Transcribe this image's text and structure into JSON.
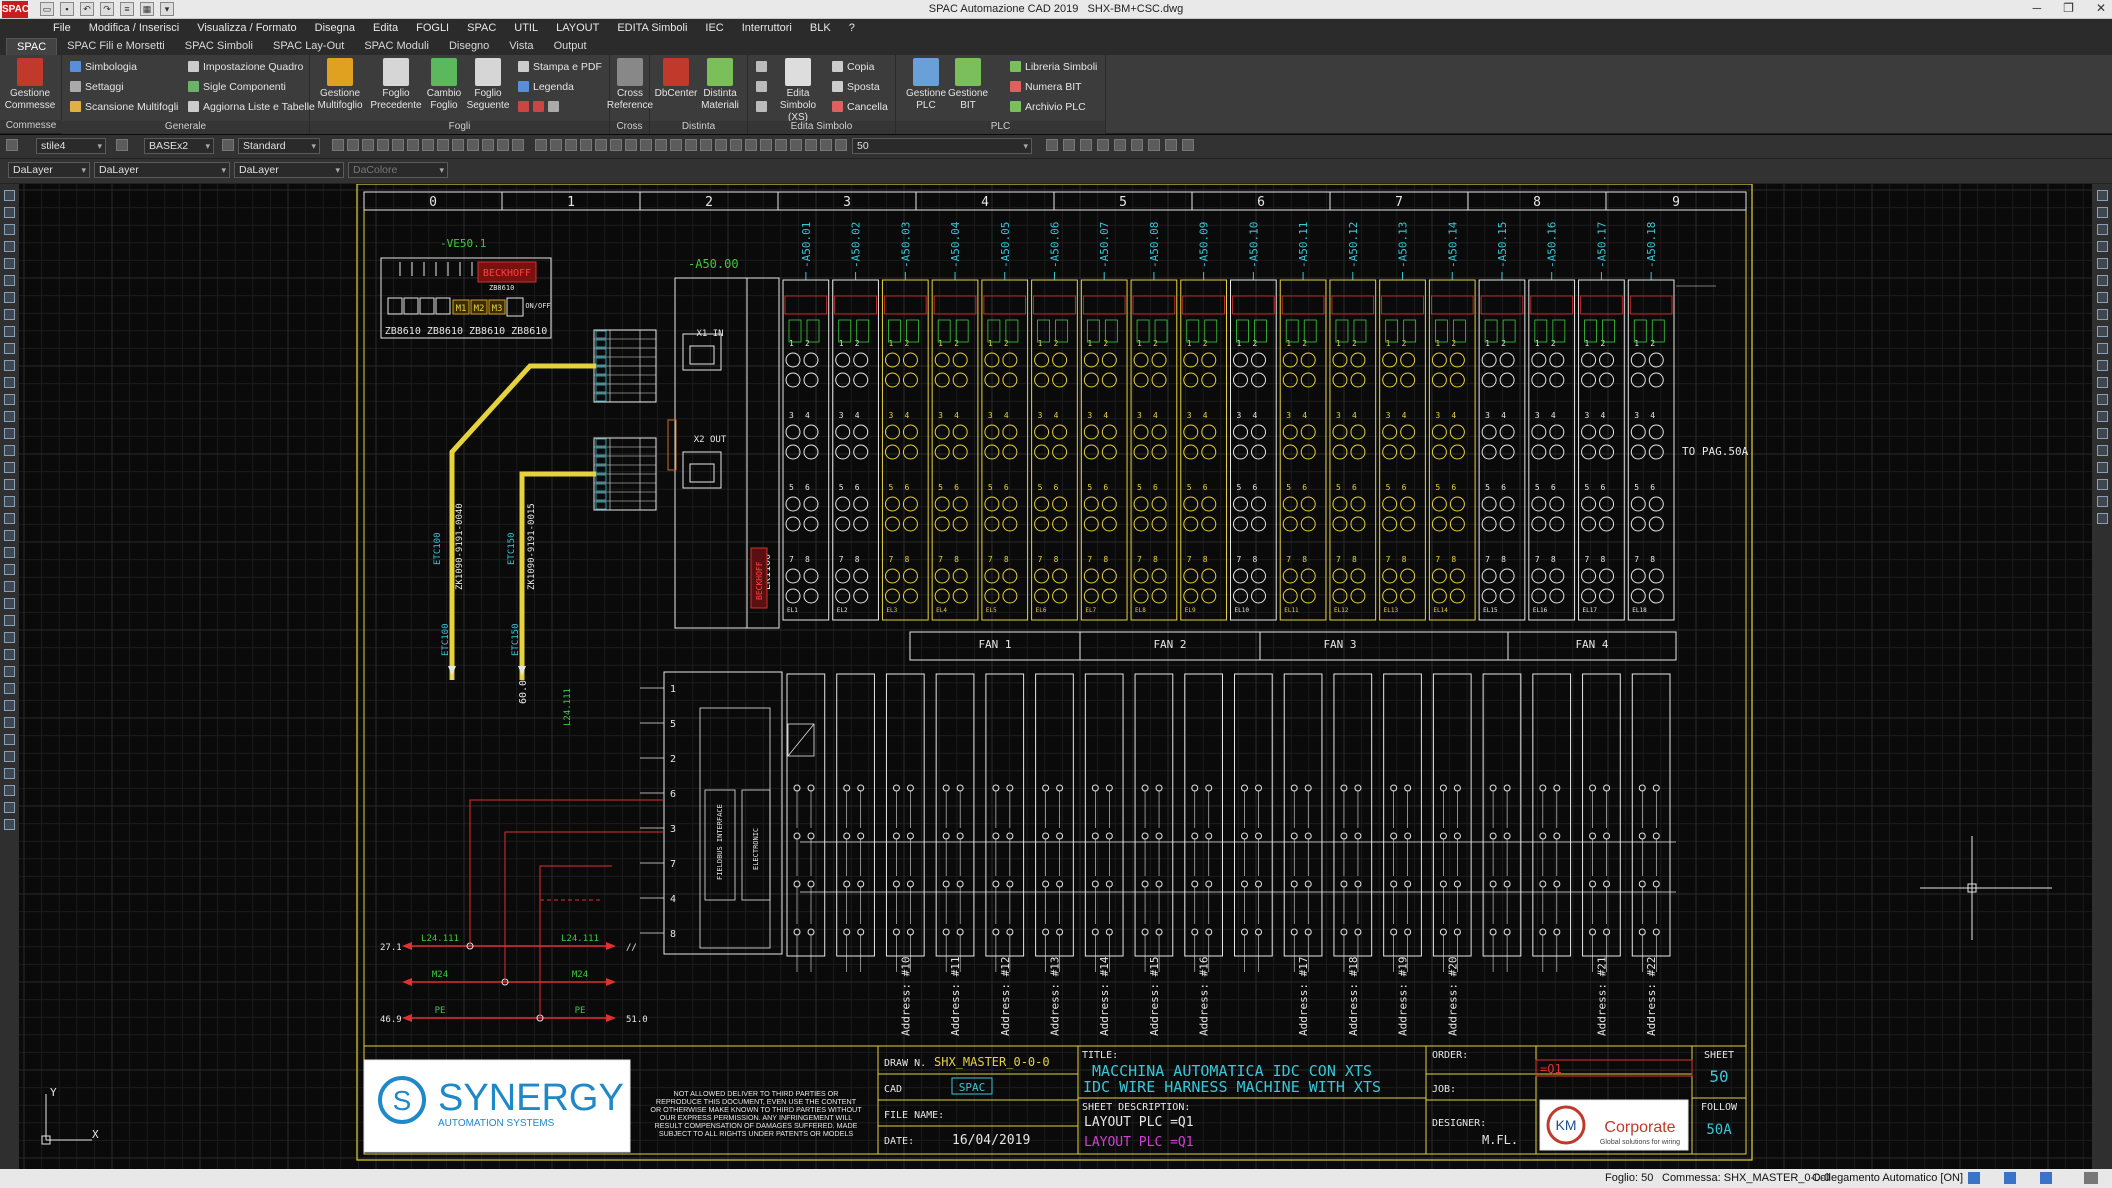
{
  "app": {
    "title": "SPAC Automazione CAD 2019",
    "file": "SHX-BM+CSC.dwg",
    "logo": "SPAC"
  },
  "menu": [
    "File",
    "Modifica / Inserisci",
    "Visualizza / Formato",
    "Disegna",
    "Edita",
    "FOGLI",
    "SPAC",
    "UTIL",
    "LAYOUT",
    "EDITA Simboli",
    "IEC",
    "Interruttori",
    "BLK",
    "?"
  ],
  "ribbon_tabs": [
    "SPAC",
    "SPAC Fili e Morsetti",
    "SPAC Simboli",
    "SPAC Lay-Out",
    "SPAC Moduli",
    "Disegno",
    "Vista",
    "Output"
  ],
  "ribbon": {
    "commesse": {
      "name": "Commesse",
      "gestione": "Gestione Commesse"
    },
    "generale": {
      "name": "Generale",
      "simbologia": "Simbologia",
      "settaggi": "Settaggi",
      "scansione": "Scansione Multifogli",
      "impostazione": "Impostazione Quadro",
      "sigle": "Sigle Componenti",
      "aggiorna": "Aggiorna Liste e Tabelle"
    },
    "fogli": {
      "name": "Fogli",
      "gestione": "Gestione Multifoglio",
      "precedente": "Foglio Precedente",
      "cambio": "Cambio Foglio",
      "seguente": "Foglio Seguente",
      "stampa": "Stampa e PDF",
      "legenda": "Legenda"
    },
    "cross": {
      "name": "Cross",
      "ref": "Cross Reference"
    },
    "distinta": {
      "name": "Distinta",
      "db": "DbCenter",
      "materiali": "Distinta Materiali"
    },
    "edita": {
      "name": "Edita Simbolo",
      "xs": "Edita Simbolo (XS)",
      "copia": "Copia",
      "sposta": "Sposta",
      "cancella": "Cancella"
    },
    "plc": {
      "name": "PLC",
      "gestione_plc": "Gestione PLC",
      "gestione_bit": "Gestione BIT",
      "libreria": "Libreria Simboli",
      "numera": "Numera BIT",
      "archivio": "Archivio PLC"
    }
  },
  "toolbar": {
    "textstyle": "stile4",
    "dimstyle": "BASEx2",
    "tablestyle": "Standard",
    "scale": "50",
    "layer": "DaLayer",
    "linetype": "DaLayer",
    "lineweight": "DaLayer",
    "color": "DaColore"
  },
  "drawing": {
    "columns": [
      "0",
      "1",
      "2",
      "3",
      "4",
      "5",
      "6",
      "7",
      "8",
      "9"
    ],
    "device_tag": "-VE50.1",
    "device_brand": "BECKHOFF",
    "device_model": "ZB8610",
    "device_cells": [
      "M1",
      "M2",
      "M3"
    ],
    "device_switch": "ON/OFF",
    "device_parts": "ZB8610 ZB8610 ZB8610 ZB8610",
    "coupler": "-A50.00",
    "coupler_model": "EK1100",
    "x1": "X1 IN",
    "x2": "X2 OUT",
    "to_page": "TO PAG.50A",
    "module_tags": [
      "-A50.01",
      "-A50.02",
      "-A50.03",
      "-A50.04",
      "-A50.05",
      "-A50.06",
      "-A50.07",
      "-A50.08",
      "-A50.09",
      "-A50.10",
      "-A50.11",
      "-A50.12",
      "-A50.13",
      "-A50.14",
      "-A50.15",
      "-A50.16",
      "-A50.17",
      "-A50.18"
    ],
    "fans": [
      "FAN 1",
      "FAN 2",
      "FAN 3",
      "FAN 4"
    ],
    "cable1": "ETC100",
    "cable1_code": "ZK1090-9191-0040",
    "cable2": "ETC150",
    "cable2_code": "ZK1090-9191-0015",
    "cable_bottom1": "ETC100",
    "cable_bottom2": "ETC150",
    "ref_600": "60.0",
    "ref_l24": "L24.111",
    "power_labels": {
      "r1": "27.1",
      "l24": "L24.111",
      "l24b": "L24.111",
      "m24": "M24",
      "m24b": "M24",
      "pe": "PE",
      "peb": "PE",
      "r46": "46.9",
      "r510": "51.0",
      "slash": "//"
    },
    "terminals": [
      "1",
      "5",
      "2",
      "6",
      "3",
      "7",
      "4",
      "8"
    ],
    "fieldbus": "FIELDBUS INTERFACE",
    "electronic": "ELECTRONIC",
    "addresses": [
      "Address: #10",
      "Address: #11",
      "Address: #12",
      "Address: #13",
      "Address: #14",
      "Address: #15",
      "Address: #16",
      "Address: #17",
      "Address: #18",
      "Address: #19",
      "Address: #20",
      "Address: #21",
      "Address: #22"
    ],
    "title_block": {
      "company": "SYNERGY",
      "company_sub": "AUTOMATION SYSTEMS",
      "disclaimer": [
        "NOT ALLOWED DELIVER TO THIRD PARTIES OR",
        "REPRODUCE THIS DOCUMENT, EVEN USE THE CONTENT",
        "OR OTHERWISE MAKE KNOWN TO THIRD PARTIES WITHOUT",
        "OUR EXPRESS PERMISSION. ANY INFRINGEMENT WILL",
        "RESULT COMPENSATION OF DAMAGES SUFFERED. MADE",
        "SUBJECT TO ALL RIGHTS UNDER PATENTS OR MODELS"
      ],
      "draw_label": "DRAW N.",
      "draw_value": "SHX_MASTER_0-0-0",
      "cad_label": "CAD",
      "cad_value": "SPAC",
      "file_label": "FILE NAME:",
      "date_label": "DATE:",
      "date_value": "16/04/2019",
      "title_label": "TITLE:",
      "title1": "MACCHINA AUTOMATICA IDC CON XTS",
      "title2": "IDC WIRE HARNESS MACHINE WITH XTS",
      "desc_label": "SHEET DESCRIPTION:",
      "desc1": "LAYOUT PLC =Q1",
      "desc2": "LAYOUT PLC =Q1",
      "order_label": "ORDER:",
      "order_value": "=Q1",
      "job_label": "JOB:",
      "designer_label": "DESIGNER:",
      "designer_value": "M.FL.",
      "sheet_label": "SHEET",
      "sheet_value": "50",
      "follow_label": "FOLLOW",
      "follow_value": "50A",
      "client": "Corporate",
      "client_sub": "Global solutions for wiring",
      "client_logo": "KM"
    }
  },
  "status": {
    "foglio": "Foglio: 50",
    "commessa": "Commessa: SHX_MASTER_0-0-0",
    "collegamento": "Collegamento Automatico [ON]"
  }
}
